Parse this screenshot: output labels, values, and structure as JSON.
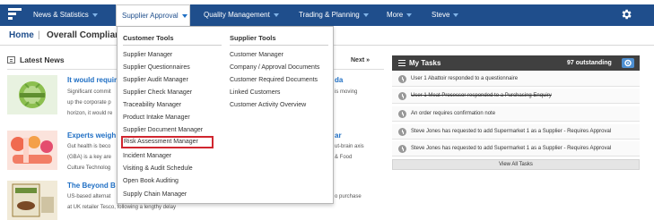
{
  "nav": {
    "items": [
      {
        "label": "News & Statistics"
      },
      {
        "label": "Supplier Approval"
      },
      {
        "label": "Quality Management"
      },
      {
        "label": "Trading & Planning"
      },
      {
        "label": "More"
      },
      {
        "label": "Steve"
      }
    ]
  },
  "breadcrumb": {
    "home": "Home",
    "separator": "|",
    "title": "Overall Complian"
  },
  "news": {
    "heading": "Latest News",
    "next": "Next »",
    "articles": [
      {
        "title": "It would requir",
        "lines": [
          "Significant commit",
          "up the corporate p",
          "horizon, it would re"
        ],
        "title_right": "da",
        "right_lines": [
          "is moving"
        ]
      },
      {
        "title": "Experts weigh",
        "lines": [
          "Gut health is beco",
          "(GBA) is a key are",
          "Culture Technolog"
        ],
        "title_right": "ar",
        "right_lines": [
          "ut-brain axis",
          "& Food"
        ]
      },
      {
        "title": "The Beyond B",
        "lines": [
          "US-based alternat",
          "at UK retailer Tesco, following a lengthy delay"
        ],
        "title_right": "",
        "right_lines": [
          "o purchase"
        ]
      }
    ]
  },
  "tasks": {
    "heading": "My Tasks",
    "count": "97 outstanding",
    "items": [
      {
        "text": "User 1 Abattoir responded to a questionnaire",
        "done": false
      },
      {
        "text": "User 1 Meat Processor responded to a Purchasing Enquiry",
        "done": true
      },
      {
        "text": "An order requires confirmation note",
        "done": false
      },
      {
        "text": "Steve Jones has requested to add Supermarket 1 as a Supplier - Requires Approval",
        "done": false
      },
      {
        "text": "Steve Jones has requested to add Supermarket 1 as a Supplier - Requires Approval",
        "done": false
      }
    ],
    "view_all": "View All Tasks"
  },
  "dropdown": {
    "customer_tools": {
      "heading": "Customer Tools",
      "items": [
        "Supplier Manager",
        "Supplier Questionnaires",
        "Supplier Audit Manager",
        "Supplier Check Manager",
        "Traceability Manager",
        "Product Intake Manager",
        "Supplier Document Manager",
        "Risk Assessment Manager",
        "Incident Manager",
        "Visiting & Audit Schedule",
        "Open Book Auditing",
        "Supply Chain Manager"
      ],
      "highlighted": "Risk Assessment Manager"
    },
    "supplier_tools": {
      "heading": "Supplier Tools",
      "items": [
        "Customer Manager",
        "Company / Approval Documents",
        "Customer Required Documents",
        "Linked Customers",
        "Customer Activity Overview"
      ]
    }
  },
  "colors": {
    "nav_bg": "#1f4e8c",
    "link": "#1f6fc4",
    "highlight_border": "#d0262f",
    "tasks_header": "#404040"
  }
}
